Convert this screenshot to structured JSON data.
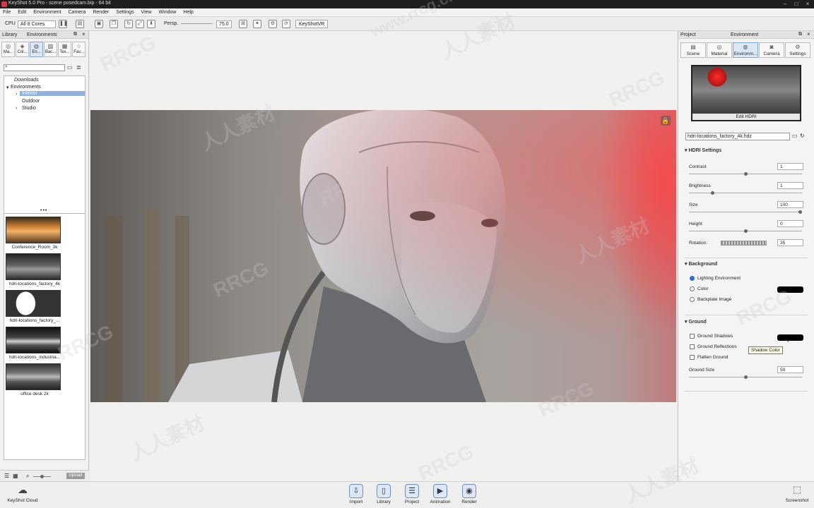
{
  "window": {
    "title": "KeyShot 5.0 Pro - scene posedcam.bip - 64 bit"
  },
  "menu": [
    "File",
    "Edit",
    "Environment",
    "Camera",
    "Render",
    "Settings",
    "View",
    "Window",
    "Help"
  ],
  "toolbar": {
    "cpu_label": "CPU",
    "cores": "All 8 Cores",
    "camera_mode": "Persp.",
    "fov": "75.0",
    "keyshotvr": "KeyShotVR"
  },
  "library": {
    "header_title": "Library",
    "header_tab": "Environments",
    "tabs": [
      {
        "label": "Ma...",
        "icon": "material-icon"
      },
      {
        "label": "Col...",
        "icon": "color-icon"
      },
      {
        "label": "En...",
        "icon": "environment-icon"
      },
      {
        "label": "Bac...",
        "icon": "backplate-icon"
      },
      {
        "label": "Tex...",
        "icon": "texture-icon"
      },
      {
        "label": "Fav...",
        "icon": "favorites-icon"
      }
    ],
    "tree": {
      "root": "Downloads",
      "folder": "Environments",
      "children": [
        "Interior",
        "Outdoor",
        "Studio"
      ]
    },
    "thumbnails": [
      {
        "caption": "Conference_Room_3k"
      },
      {
        "caption": "hdri-locations_factory_4k"
      },
      {
        "caption": "hdri-locations_factory_..."
      },
      {
        "caption": "hdri-locations_industria..."
      },
      {
        "caption": "office desk 2k"
      }
    ],
    "upload_label": "Upload"
  },
  "project": {
    "header_title": "Project",
    "header_tab": "Environment",
    "tabs": [
      {
        "label": "Scene",
        "icon": "scene-icon"
      },
      {
        "label": "Material",
        "icon": "material-icon"
      },
      {
        "label": "Environm...",
        "icon": "environment-icon"
      },
      {
        "label": "Camera",
        "icon": "camera-icon"
      },
      {
        "label": "Settings",
        "icon": "settings-icon"
      }
    ],
    "edit_hdri": "Edit HDRI",
    "hdri_file": "hdri-locations_factory_4k.hdz",
    "hdri_settings": {
      "title": "HDRI Settings",
      "contrast": {
        "label": "Contrast",
        "value": "1",
        "level": 0.5
      },
      "brightness": {
        "label": "Brightness",
        "value": "1",
        "level": 0.2
      },
      "size": {
        "label": "Size",
        "value": "100",
        "level": 1.0
      },
      "height": {
        "label": "Height",
        "value": "0",
        "level": 0.5
      },
      "rotation": {
        "label": "Rotation",
        "value": "35"
      }
    },
    "background": {
      "title": "Background",
      "options": [
        "Lighting Environment",
        "Color",
        "Backplate Image"
      ],
      "selected": "Lighting Environment",
      "color_swatch": "#000000"
    },
    "ground": {
      "title": "Ground",
      "shadows": "Ground Shadows",
      "reflections": "Ground Reflections",
      "flatten": "Flatten Ground",
      "size_label": "Ground Size",
      "size_value": "50",
      "size_level": 0.5,
      "shadow_color": "#000000",
      "tooltip": "Shadow Color"
    }
  },
  "bottom": {
    "cloud": "KeyShot Cloud",
    "buttons": [
      {
        "label": "Import",
        "icon": "import-icon"
      },
      {
        "label": "Library",
        "icon": "library-icon"
      },
      {
        "label": "Project",
        "icon": "project-icon"
      },
      {
        "label": "Animation",
        "icon": "animation-icon"
      },
      {
        "label": "Render",
        "icon": "render-icon"
      }
    ],
    "screenshot": "Screenshot"
  },
  "watermarks": [
    "www.rrcg.cn",
    "RRCG",
    "人人素材"
  ]
}
